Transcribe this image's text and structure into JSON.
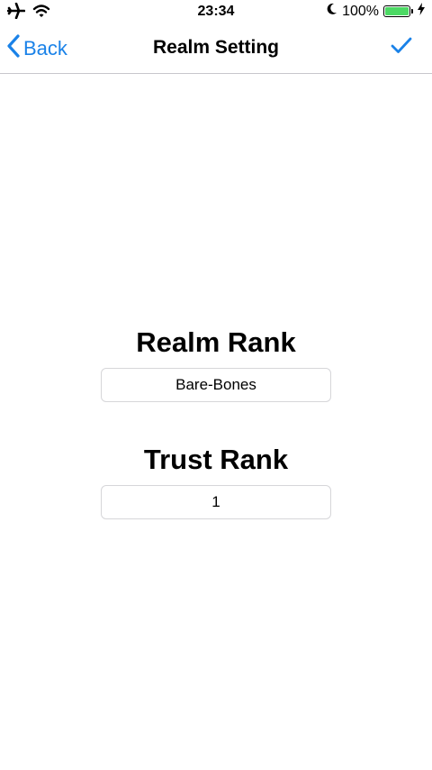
{
  "status_bar": {
    "time": "23:34",
    "battery_text": "100%",
    "battery_level": 1.0,
    "icons": [
      "airplane-icon",
      "wifi-icon",
      "moon-icon",
      "battery-icon",
      "charging-bolt-icon"
    ]
  },
  "nav": {
    "back_label": "Back",
    "title": "Realm Setting",
    "done_icon": "checkmark-icon",
    "accent_color": "#1a82e8"
  },
  "realm_rank": {
    "title": "Realm Rank",
    "value": "Bare-Bones"
  },
  "trust_rank": {
    "title": "Trust Rank",
    "value": "1"
  }
}
